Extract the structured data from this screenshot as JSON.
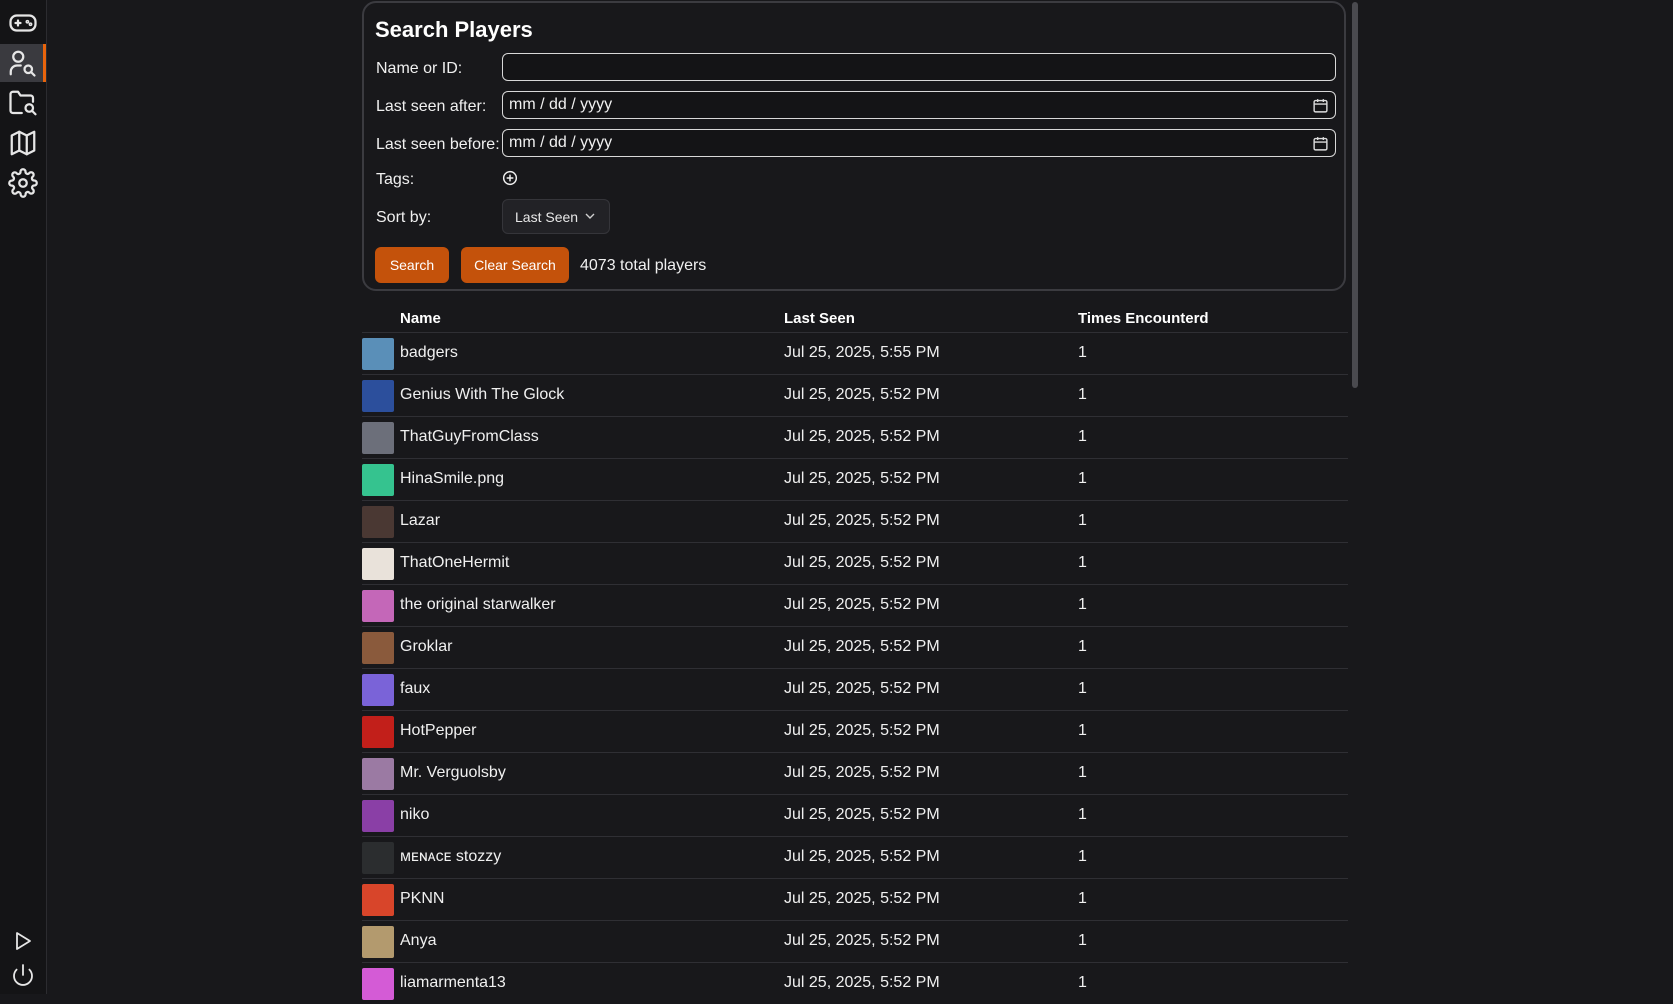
{
  "sidebar": {
    "items": [
      {
        "name": "games",
        "icon": "gamepad-icon"
      },
      {
        "name": "players",
        "icon": "user-search-icon",
        "active": true
      },
      {
        "name": "folder-search",
        "icon": "folder-search-icon"
      },
      {
        "name": "map",
        "icon": "map-icon"
      },
      {
        "name": "settings",
        "icon": "gear-icon"
      }
    ],
    "bottom": [
      {
        "name": "play",
        "icon": "play-icon"
      },
      {
        "name": "power",
        "icon": "power-icon"
      }
    ]
  },
  "search": {
    "title": "Search Players",
    "name_label": "Name or ID:",
    "name_value": "",
    "after_label": "Last seen after:",
    "after_placeholder": "mm / dd / yyyy",
    "before_label": "Last seen before:",
    "before_placeholder": "mm / dd / yyyy",
    "tags_label": "Tags:",
    "sort_label": "Sort by:",
    "sort_value": "Last Seen",
    "search_button": "Search",
    "clear_button": "Clear Search",
    "total_text": "4073 total players"
  },
  "table": {
    "headers": {
      "name": "Name",
      "last_seen": "Last Seen",
      "times": "Times Encounterd"
    },
    "rows": [
      {
        "name": "badgers",
        "last_seen": "Jul 25, 2025, 5:55 PM",
        "times": "1",
        "avatar_color": "#5a8fb8"
      },
      {
        "name": "Genius With The Glock",
        "last_seen": "Jul 25, 2025, 5:52 PM",
        "times": "1",
        "avatar_color": "#2c4f9c"
      },
      {
        "name": "ThatGuyFromClass",
        "last_seen": "Jul 25, 2025, 5:52 PM",
        "times": "1",
        "avatar_color": "#6c6f7a"
      },
      {
        "name": "HinaSmile.png",
        "last_seen": "Jul 25, 2025, 5:52 PM",
        "times": "1",
        "avatar_color": "#35c38f"
      },
      {
        "name": "Lazar",
        "last_seen": "Jul 25, 2025, 5:52 PM",
        "times": "1",
        "avatar_color": "#4a3833"
      },
      {
        "name": "ThatOneHermit",
        "last_seen": "Jul 25, 2025, 5:52 PM",
        "times": "1",
        "avatar_color": "#e9e2da"
      },
      {
        "name": "the original starwalker",
        "last_seen": "Jul 25, 2025, 5:52 PM",
        "times": "1",
        "avatar_color": "#c467b8"
      },
      {
        "name": "Groklar",
        "last_seen": "Jul 25, 2025, 5:52 PM",
        "times": "1",
        "avatar_color": "#8a5a3c"
      },
      {
        "name": "faux",
        "last_seen": "Jul 25, 2025, 5:52 PM",
        "times": "1",
        "avatar_color": "#7a63d8"
      },
      {
        "name": "HotPepper",
        "last_seen": "Jul 25, 2025, 5:52 PM",
        "times": "1",
        "avatar_color": "#c21f1a"
      },
      {
        "name": "Mr. Verguolsby",
        "last_seen": "Jul 25, 2025, 5:52 PM",
        "times": "1",
        "avatar_color": "#9b7aa3"
      },
      {
        "name": "niko",
        "last_seen": "Jul 25, 2025, 5:52 PM",
        "times": "1",
        "avatar_color": "#8a3fa6"
      },
      {
        "name": "ᴍᴇɴᴀᴄᴇ stozzy",
        "last_seen": "Jul 25, 2025, 5:52 PM",
        "times": "1",
        "avatar_color": "#2b2d2f"
      },
      {
        "name": "PKNN",
        "last_seen": "Jul 25, 2025, 5:52 PM",
        "times": "1",
        "avatar_color": "#d8452a"
      },
      {
        "name": "Anya",
        "last_seen": "Jul 25, 2025, 5:52 PM",
        "times": "1",
        "avatar_color": "#b39a6e"
      },
      {
        "name": "liamarmenta13",
        "last_seen": "Jul 25, 2025, 5:52 PM",
        "times": "1",
        "avatar_color": "#d45bd6"
      }
    ]
  },
  "colors": {
    "accent": "#c4520b",
    "background": "#18181b",
    "active_indicator": "#e8640c"
  }
}
